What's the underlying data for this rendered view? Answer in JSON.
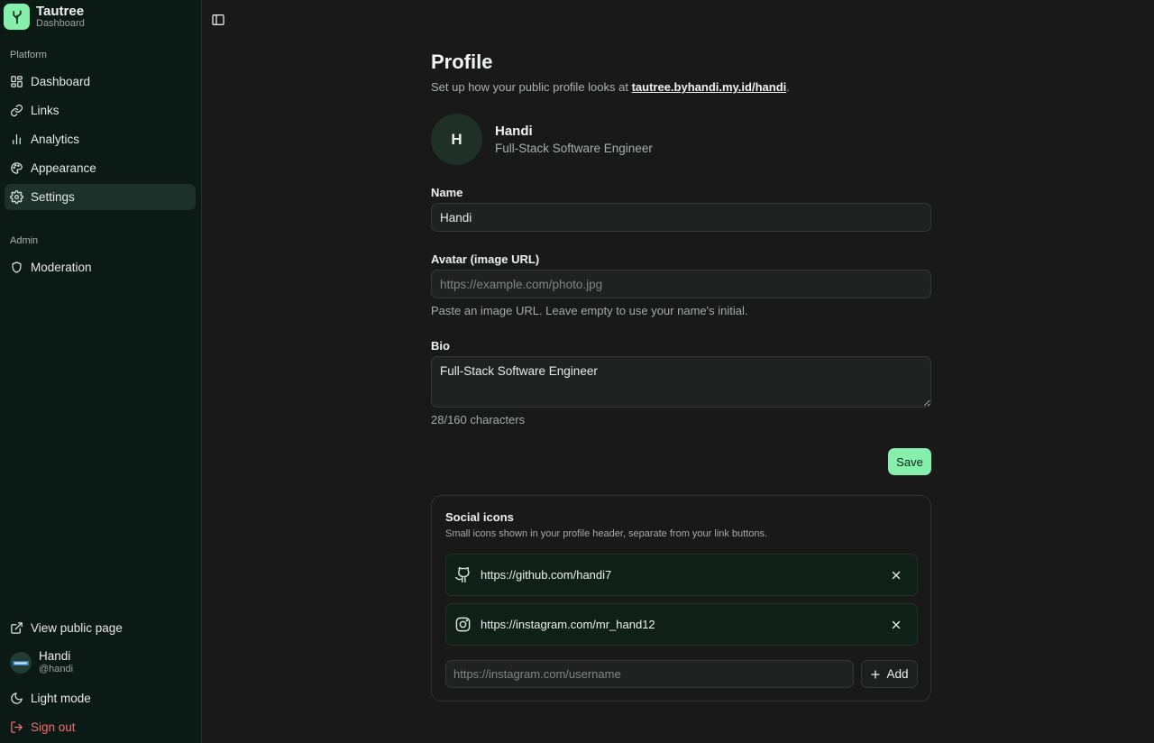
{
  "brand": {
    "title": "Tautree",
    "subtitle": "Dashboard"
  },
  "sidebar": {
    "platform_label": "Platform",
    "items": [
      {
        "label": "Dashboard",
        "icon": "dashboard-icon"
      },
      {
        "label": "Links",
        "icon": "link-icon"
      },
      {
        "label": "Analytics",
        "icon": "bar-chart-icon"
      },
      {
        "label": "Appearance",
        "icon": "palette-icon"
      },
      {
        "label": "Settings",
        "icon": "gear-icon",
        "active": true
      }
    ],
    "admin_label": "Admin",
    "admin_items": [
      {
        "label": "Moderation",
        "icon": "shield-icon"
      }
    ],
    "footer": {
      "view_public": "View public page",
      "user_name": "Handi",
      "user_handle": "@handi",
      "theme_toggle": "Light mode",
      "sign_out": "Sign out"
    }
  },
  "page": {
    "title": "Profile",
    "subtitle_prefix": "Set up how your public profile looks at ",
    "public_url": "tautree.byhandi.my.id/handi",
    "subtitle_suffix": "."
  },
  "profile": {
    "initial": "H",
    "name": "Handi",
    "role": "Full-Stack Software Engineer"
  },
  "form": {
    "name_label": "Name",
    "name_value": "Handi",
    "avatar_label": "Avatar (image URL)",
    "avatar_placeholder": "https://example.com/photo.jpg",
    "avatar_hint": "Paste an image URL. Leave empty to use your name's initial.",
    "bio_label": "Bio",
    "bio_value": "Full-Stack Software Engineer",
    "bio_count": "28/160 characters",
    "save_label": "Save"
  },
  "social": {
    "title": "Social icons",
    "subtitle": "Small icons shown in your profile header, separate from your link buttons.",
    "items": [
      {
        "url": "https://github.com/handi7",
        "icon": "github-icon"
      },
      {
        "url": "https://instagram.com/mr_hand12",
        "icon": "instagram-icon"
      }
    ],
    "add_placeholder": "https://instagram.com/username",
    "add_label": "Add"
  },
  "colors": {
    "accent": "#86efac",
    "sidebar_bg": "#0c1a16",
    "main_bg": "#191919",
    "danger": "#f26d6d"
  }
}
